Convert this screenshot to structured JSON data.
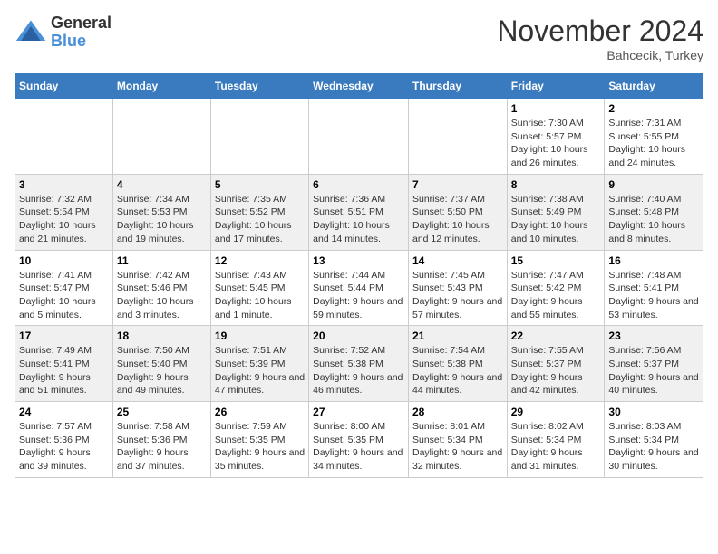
{
  "logo": {
    "general": "General",
    "blue": "Blue"
  },
  "header": {
    "month": "November 2024",
    "location": "Bahcecik, Turkey"
  },
  "weekdays": [
    "Sunday",
    "Monday",
    "Tuesday",
    "Wednesday",
    "Thursday",
    "Friday",
    "Saturday"
  ],
  "weeks": [
    [
      {
        "day": "",
        "info": ""
      },
      {
        "day": "",
        "info": ""
      },
      {
        "day": "",
        "info": ""
      },
      {
        "day": "",
        "info": ""
      },
      {
        "day": "",
        "info": ""
      },
      {
        "day": "1",
        "info": "Sunrise: 7:30 AM\nSunset: 5:57 PM\nDaylight: 10 hours and 26 minutes."
      },
      {
        "day": "2",
        "info": "Sunrise: 7:31 AM\nSunset: 5:55 PM\nDaylight: 10 hours and 24 minutes."
      }
    ],
    [
      {
        "day": "3",
        "info": "Sunrise: 7:32 AM\nSunset: 5:54 PM\nDaylight: 10 hours and 21 minutes."
      },
      {
        "day": "4",
        "info": "Sunrise: 7:34 AM\nSunset: 5:53 PM\nDaylight: 10 hours and 19 minutes."
      },
      {
        "day": "5",
        "info": "Sunrise: 7:35 AM\nSunset: 5:52 PM\nDaylight: 10 hours and 17 minutes."
      },
      {
        "day": "6",
        "info": "Sunrise: 7:36 AM\nSunset: 5:51 PM\nDaylight: 10 hours and 14 minutes."
      },
      {
        "day": "7",
        "info": "Sunrise: 7:37 AM\nSunset: 5:50 PM\nDaylight: 10 hours and 12 minutes."
      },
      {
        "day": "8",
        "info": "Sunrise: 7:38 AM\nSunset: 5:49 PM\nDaylight: 10 hours and 10 minutes."
      },
      {
        "day": "9",
        "info": "Sunrise: 7:40 AM\nSunset: 5:48 PM\nDaylight: 10 hours and 8 minutes."
      }
    ],
    [
      {
        "day": "10",
        "info": "Sunrise: 7:41 AM\nSunset: 5:47 PM\nDaylight: 10 hours and 5 minutes."
      },
      {
        "day": "11",
        "info": "Sunrise: 7:42 AM\nSunset: 5:46 PM\nDaylight: 10 hours and 3 minutes."
      },
      {
        "day": "12",
        "info": "Sunrise: 7:43 AM\nSunset: 5:45 PM\nDaylight: 10 hours and 1 minute."
      },
      {
        "day": "13",
        "info": "Sunrise: 7:44 AM\nSunset: 5:44 PM\nDaylight: 9 hours and 59 minutes."
      },
      {
        "day": "14",
        "info": "Sunrise: 7:45 AM\nSunset: 5:43 PM\nDaylight: 9 hours and 57 minutes."
      },
      {
        "day": "15",
        "info": "Sunrise: 7:47 AM\nSunset: 5:42 PM\nDaylight: 9 hours and 55 minutes."
      },
      {
        "day": "16",
        "info": "Sunrise: 7:48 AM\nSunset: 5:41 PM\nDaylight: 9 hours and 53 minutes."
      }
    ],
    [
      {
        "day": "17",
        "info": "Sunrise: 7:49 AM\nSunset: 5:41 PM\nDaylight: 9 hours and 51 minutes."
      },
      {
        "day": "18",
        "info": "Sunrise: 7:50 AM\nSunset: 5:40 PM\nDaylight: 9 hours and 49 minutes."
      },
      {
        "day": "19",
        "info": "Sunrise: 7:51 AM\nSunset: 5:39 PM\nDaylight: 9 hours and 47 minutes."
      },
      {
        "day": "20",
        "info": "Sunrise: 7:52 AM\nSunset: 5:38 PM\nDaylight: 9 hours and 46 minutes."
      },
      {
        "day": "21",
        "info": "Sunrise: 7:54 AM\nSunset: 5:38 PM\nDaylight: 9 hours and 44 minutes."
      },
      {
        "day": "22",
        "info": "Sunrise: 7:55 AM\nSunset: 5:37 PM\nDaylight: 9 hours and 42 minutes."
      },
      {
        "day": "23",
        "info": "Sunrise: 7:56 AM\nSunset: 5:37 PM\nDaylight: 9 hours and 40 minutes."
      }
    ],
    [
      {
        "day": "24",
        "info": "Sunrise: 7:57 AM\nSunset: 5:36 PM\nDaylight: 9 hours and 39 minutes."
      },
      {
        "day": "25",
        "info": "Sunrise: 7:58 AM\nSunset: 5:36 PM\nDaylight: 9 hours and 37 minutes."
      },
      {
        "day": "26",
        "info": "Sunrise: 7:59 AM\nSunset: 5:35 PM\nDaylight: 9 hours and 35 minutes."
      },
      {
        "day": "27",
        "info": "Sunrise: 8:00 AM\nSunset: 5:35 PM\nDaylight: 9 hours and 34 minutes."
      },
      {
        "day": "28",
        "info": "Sunrise: 8:01 AM\nSunset: 5:34 PM\nDaylight: 9 hours and 32 minutes."
      },
      {
        "day": "29",
        "info": "Sunrise: 8:02 AM\nSunset: 5:34 PM\nDaylight: 9 hours and 31 minutes."
      },
      {
        "day": "30",
        "info": "Sunrise: 8:03 AM\nSunset: 5:34 PM\nDaylight: 9 hours and 30 minutes."
      }
    ]
  ]
}
